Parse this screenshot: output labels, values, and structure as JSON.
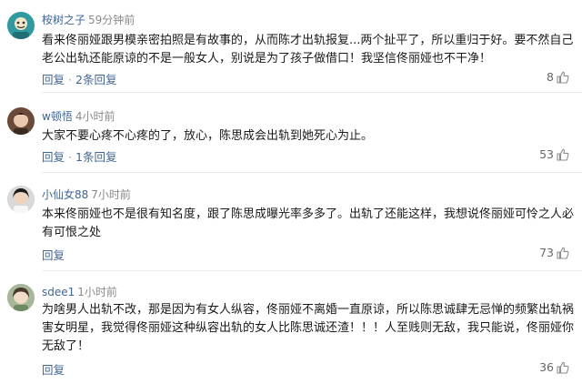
{
  "comments": [
    {
      "username": "桉树之子",
      "time": "59分钟前",
      "text": "看来佟丽娅跟男模亲密拍照是有故事的，从而陈才出轨报复...两个扯平了，所以重归于好。要不然自己老公出轨还能原谅的不是一般女人，别说是为了孩子做借口！我坚信佟丽娅也不干净！",
      "reply_label": "回复",
      "reply_count": "2条回复",
      "likes": "8"
    },
    {
      "username": "w顿悟",
      "time": "4小时前",
      "text": "大家不要心疼不心疼的了，放心，陈思成会出轨到她死心为止。",
      "reply_label": "回复",
      "reply_count": "1条回复",
      "likes": "53"
    },
    {
      "username": "小仙女88",
      "time": "7小时前",
      "text": "本来佟丽娅也不是很有知名度，跟了陈思成曝光率多多了。出轨了还能这样，我想说佟丽娅可怜之人必有可恨之处",
      "reply_label": "回复",
      "likes": "73"
    },
    {
      "username": "sdee1",
      "time": "1小时前",
      "text": "为啥男人出轨不改，那是因为有女人纵容，佟丽娅不离婚一直原谅，所以陈思诚肆无忌惮的频繁出轨祸害女明星，我觉得佟丽娅这种纵容出轨的女人比陈思诚还渣！！！人至贱则无敌，我只能说，佟丽娅你无敌了！",
      "reply_label": "回复",
      "likes": "36"
    }
  ],
  "icons": {
    "like": "thumbs-up-icon"
  },
  "colors": {
    "username": "#406599",
    "meta": "#8a8a8a",
    "text": "#1a1a1a"
  }
}
